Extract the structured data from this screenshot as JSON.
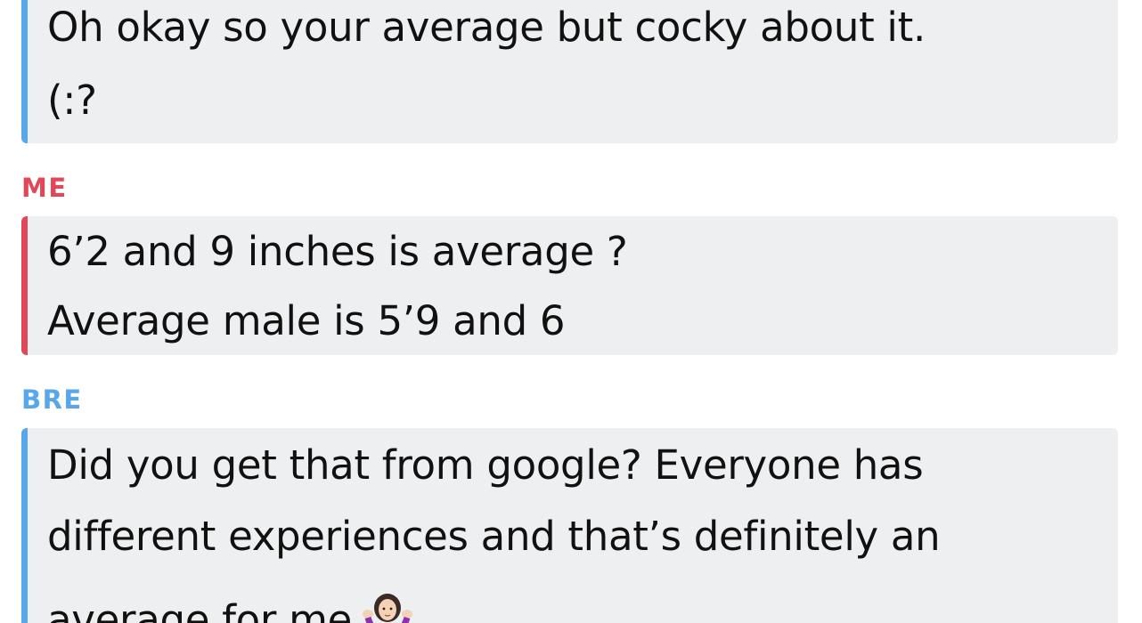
{
  "messages": [
    {
      "lines": [
        "Oh okay so your average but cocky about it.",
        "(:?"
      ]
    },
    {
      "sender": "ME",
      "lines": [
        "6’2 and 9 inches is average ?",
        "Average male is 5’9 and 6"
      ]
    },
    {
      "sender": "BRE",
      "lines": [
        "Did you get that from google?  Everyone has",
        "different experiences and that’s definitely an",
        "average for me"
      ],
      "emoji": "person-shrugging-emoji"
    }
  ],
  "colors": {
    "friend_accent": "#57a7ea",
    "me_accent": "#e0485a",
    "bubble_bg": "#eeeff1"
  }
}
